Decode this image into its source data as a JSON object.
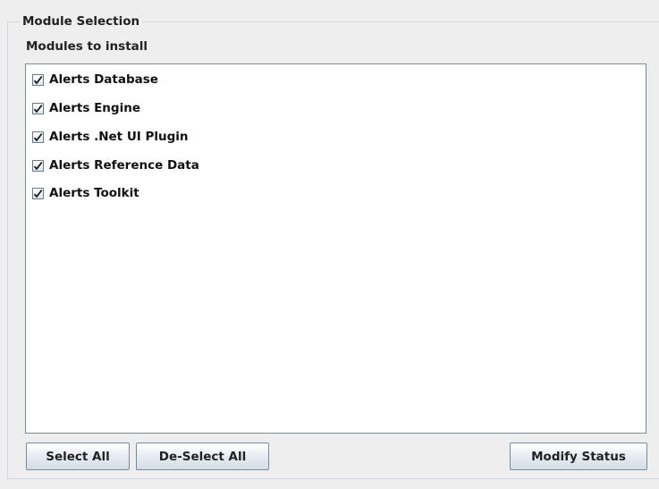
{
  "group": {
    "title": "Module Selection",
    "subtitle": "Modules to install"
  },
  "modules": {
    "items": [
      {
        "label": "Alerts Database",
        "checked": true
      },
      {
        "label": "Alerts Engine",
        "checked": true
      },
      {
        "label": "Alerts .Net UI Plugin",
        "checked": true
      },
      {
        "label": "Alerts Reference Data",
        "checked": true
      },
      {
        "label": "Alerts Toolkit",
        "checked": true
      }
    ]
  },
  "buttons": {
    "select_all": "Select All",
    "deselect_all": "De-Select All",
    "modify_status": "Modify Status"
  },
  "icons": {
    "checkbox_checked": "checkmark-icon"
  }
}
